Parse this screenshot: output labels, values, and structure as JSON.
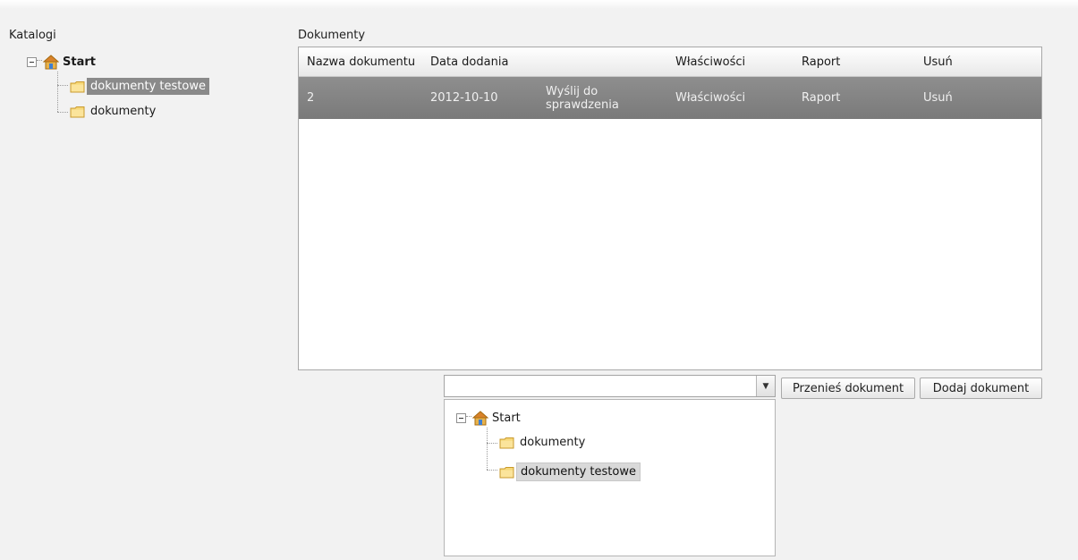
{
  "catalogs": {
    "label": "Katalogi",
    "root": "Start",
    "items": [
      "dokumenty testowe",
      "dokumenty"
    ],
    "selected": "dokumenty testowe"
  },
  "documents": {
    "label": "Dokumenty",
    "columns": [
      "Nazwa dokumentu",
      "Data dodania",
      "",
      "Właściwości",
      "Raport",
      "Usuń"
    ],
    "rows": [
      {
        "name": "2",
        "date": "2012-10-10",
        "action": "Wyślij do sprawdzenia",
        "properties": "Właściwości",
        "report": "Raport",
        "delete": "Usuń"
      }
    ]
  },
  "move": {
    "combo_value": "",
    "move_button": "Przenieś dokument",
    "add_button": "Dodaj dokument",
    "dropdown_tree": {
      "root": "Start",
      "items": [
        "dokumenty",
        "dokumenty testowe"
      ],
      "selected": "dokumenty testowe"
    }
  },
  "colors": {
    "selected_row": "#858585",
    "background": "#f2f2f2"
  },
  "icons": {
    "root": "home-icon",
    "folder": "folder-icon",
    "expander": "collapse-icon",
    "combo": "chevron-down-icon"
  }
}
